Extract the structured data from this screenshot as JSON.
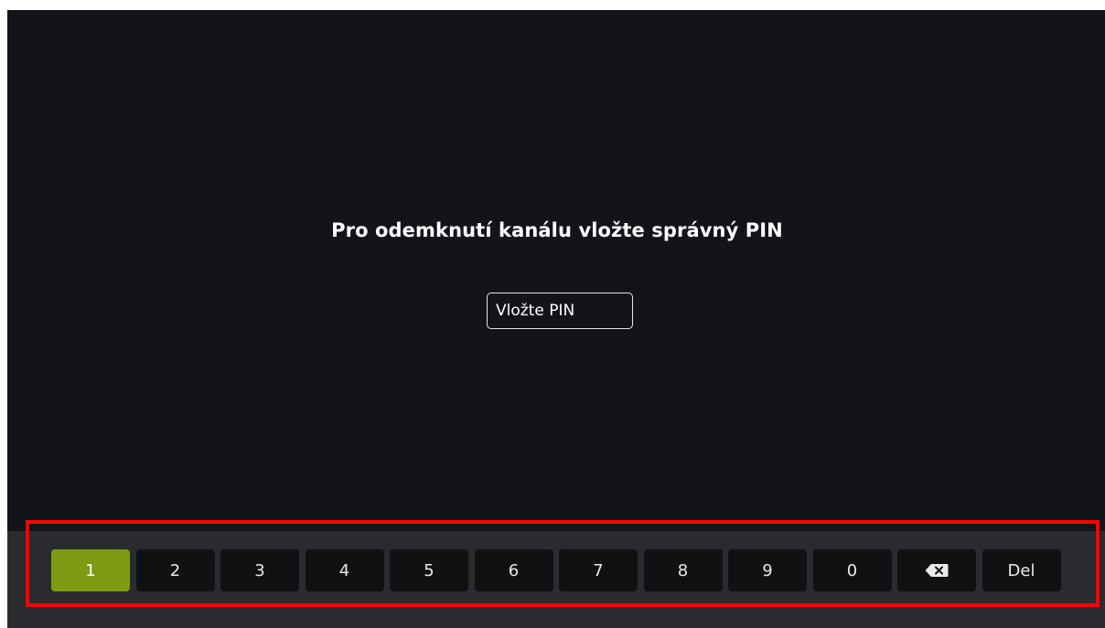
{
  "screen": {
    "prompt_text": "Pro odemknutí kanálu vložte správný PIN",
    "pin_input": {
      "placeholder": "Vložte PIN",
      "value": ""
    }
  },
  "keypad": {
    "keys": [
      {
        "label": "1",
        "active": true
      },
      {
        "label": "2"
      },
      {
        "label": "3"
      },
      {
        "label": "4"
      },
      {
        "label": "5"
      },
      {
        "label": "6"
      },
      {
        "label": "7"
      },
      {
        "label": "8"
      },
      {
        "label": "9"
      },
      {
        "label": "0"
      },
      {
        "icon": "backspace-icon"
      },
      {
        "label": "Del"
      }
    ]
  },
  "colors": {
    "background": "#121419",
    "keyboard_bar": "#2a2b2e",
    "key": "#101113",
    "key_active": "#7e9b12",
    "highlight": "#ff0000"
  }
}
